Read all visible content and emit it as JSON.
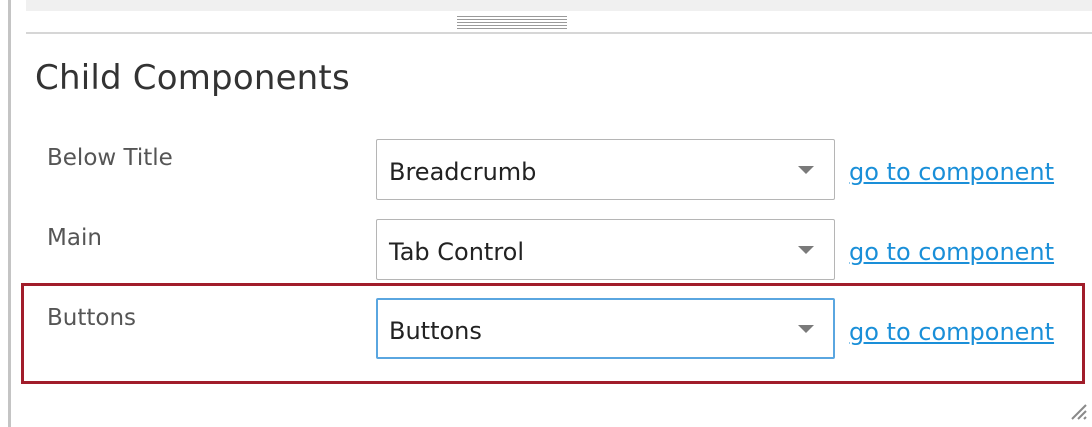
{
  "section": {
    "title": "Child Components"
  },
  "rows": [
    {
      "label": "Below Title",
      "selected": "Breadcrumb",
      "link": "go to component"
    },
    {
      "label": "Main",
      "selected": "Tab Control",
      "link": "go to component"
    },
    {
      "label": "Buttons",
      "selected": "Buttons",
      "link": "go to component"
    }
  ],
  "colors": {
    "highlight": "#a11d2a",
    "link": "#1a8fd8",
    "focus_border": "#5aa6e0"
  },
  "icons": {
    "dropdown": "chevron-down-icon",
    "splitter": "splitter-grip-icon",
    "resize": "resize-grip-icon"
  }
}
